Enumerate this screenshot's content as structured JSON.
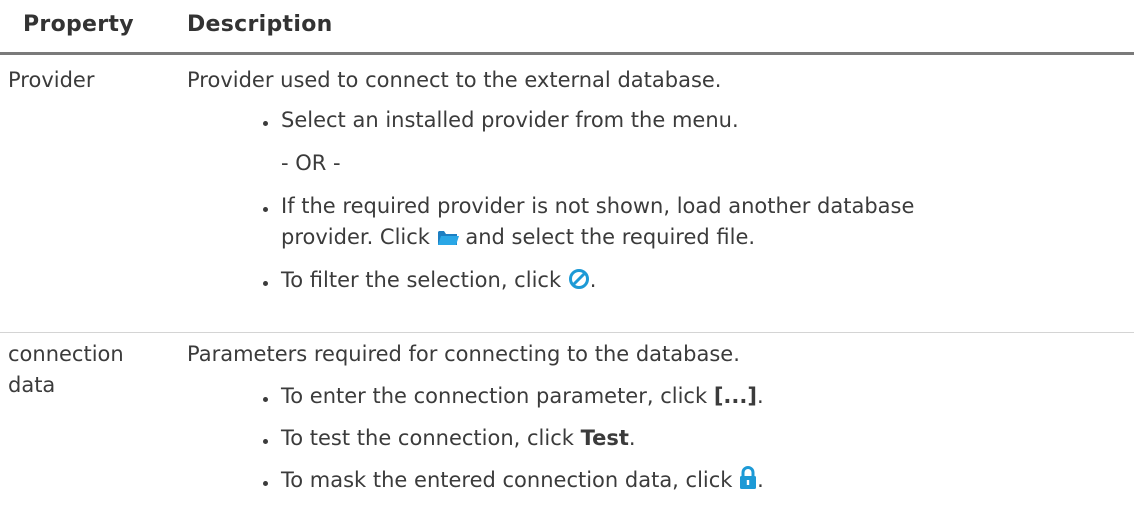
{
  "header": {
    "property_label": "Property",
    "description_label": "Description"
  },
  "rows": [
    {
      "property": "Provider",
      "intro": "Provider used to connect to the external database.",
      "bullet1": "Select an installed provider from the menu.",
      "or_text": "- OR -",
      "bullet2_line1": "If the required provider is not shown, load another database",
      "bullet2_pre": "provider. Click",
      "bullet2_post": "and select the required file.",
      "bullet3_pre": "To filter the selection, click",
      "bullet3_post": ".",
      "folder_icon": "folder-icon",
      "filter_icon": "filter-clear-icon"
    },
    {
      "property_line1": "connection",
      "property_line2": "data",
      "intro": "Parameters required for connecting to the database.",
      "bullet1_pre": "To enter the connection parameter, click",
      "bullet1_bold": "[...]",
      "bullet1_post": ".",
      "bullet2_pre": "To test the connection, click",
      "bullet2_bold": "Test",
      "bullet2_post": ".",
      "bullet3_pre": "To mask the entered connection data, click",
      "bullet3_post": ".",
      "lock_icon": "lock-icon"
    }
  ],
  "colors": {
    "text": "#3b3b3b",
    "header_rule": "#7a7a7a",
    "row_divider": "#d4d4d4",
    "icon_blue": "#1d9ad6"
  }
}
